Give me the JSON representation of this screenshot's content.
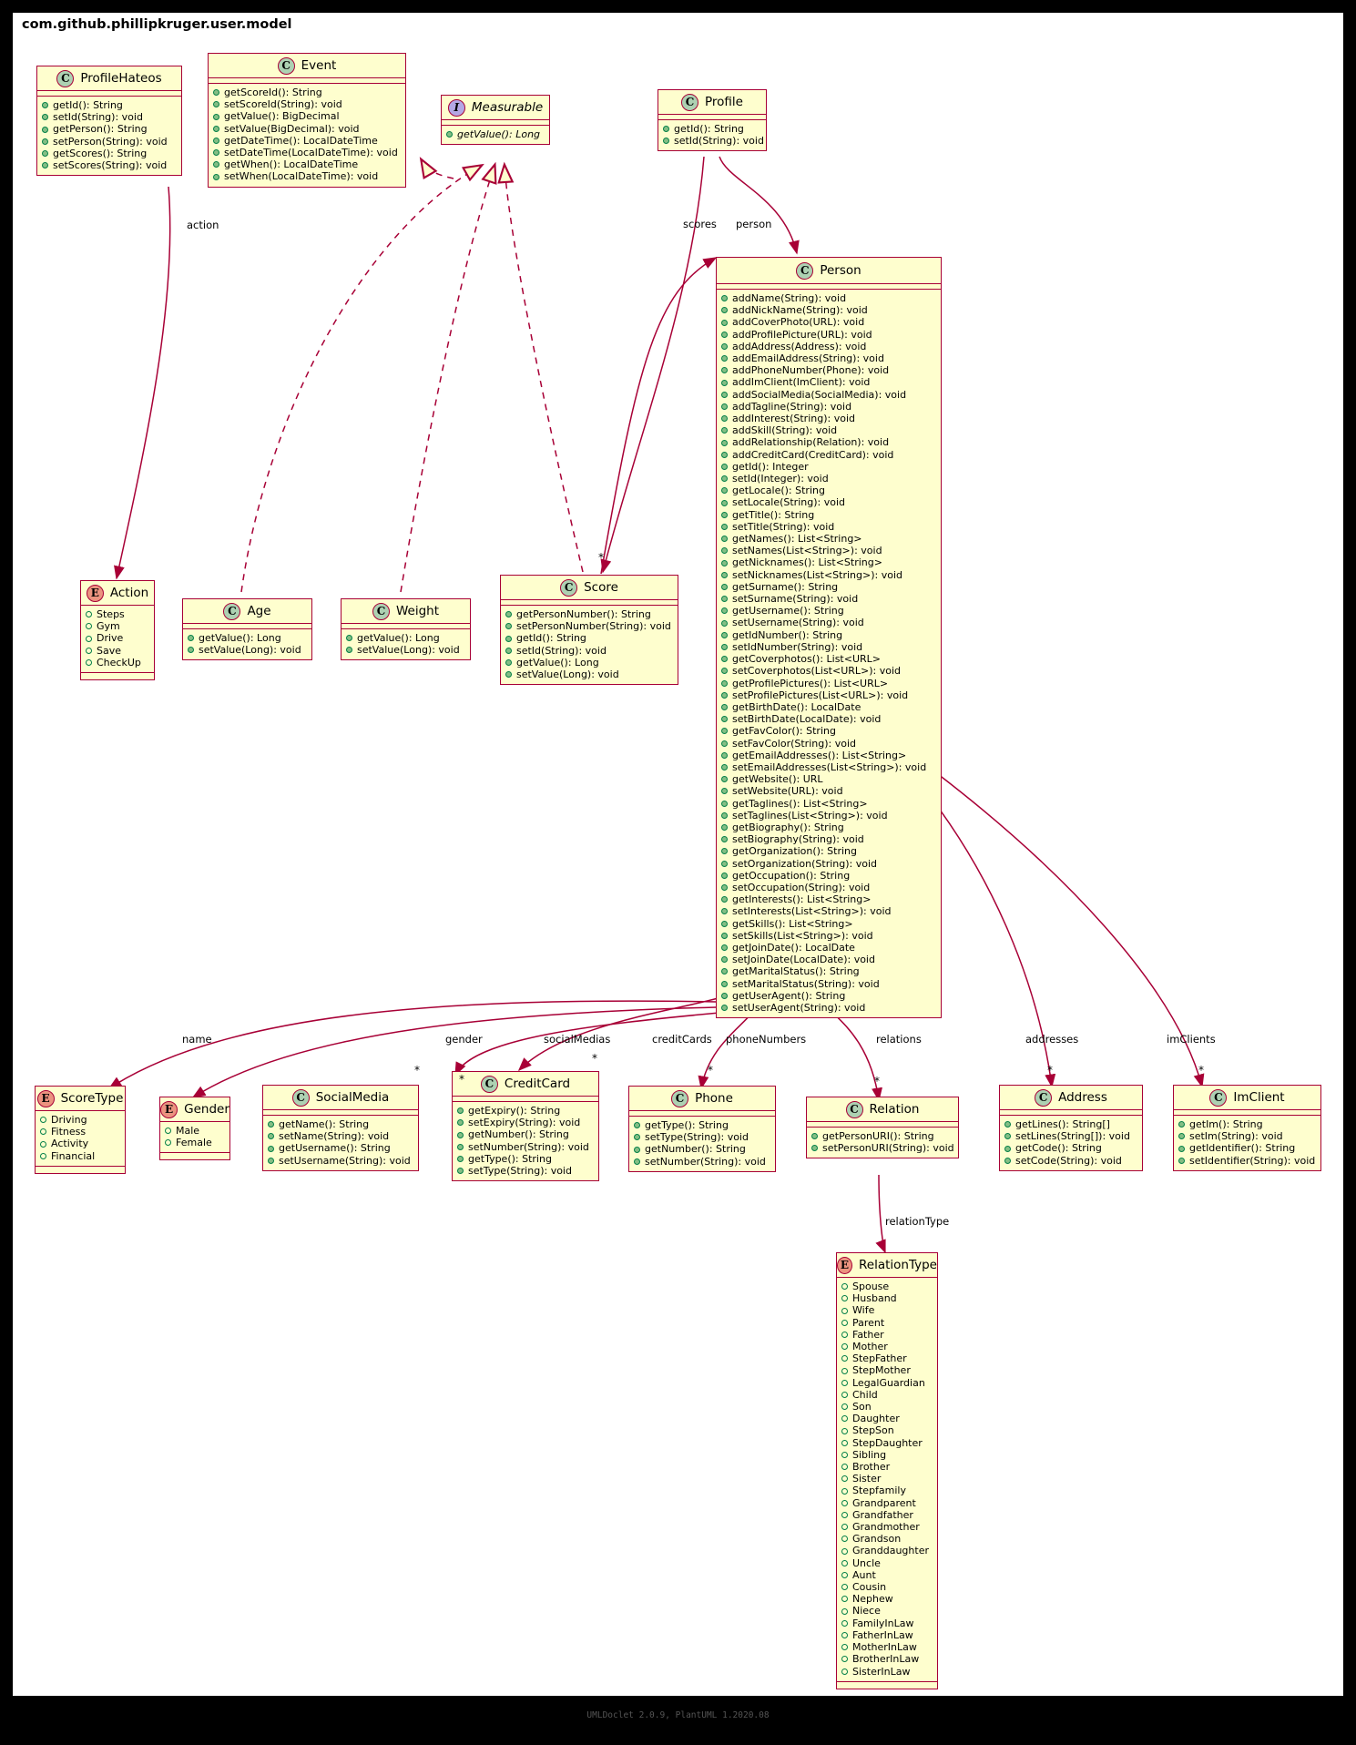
{
  "package": {
    "label": "com.github.phillipkruger.user.model"
  },
  "footer": {
    "text": "UMLDoclet 2.0.9, PlantUML 1.2020.08"
  },
  "colors": {
    "border": "#A80036",
    "fill": "#FEFECE",
    "class_badge": "#ADD1B2",
    "interface_badge": "#B4A7E5",
    "enum_badge": "#EB937F",
    "member_dot": "#038048"
  },
  "nodes": {
    "profilehateos": {
      "stereotype": "C",
      "name": "ProfileHateos",
      "members": [
        "getId(): String",
        "setId(String): void",
        "getPerson(): String",
        "setPerson(String): void",
        "getScores(): String",
        "setScores(String): void"
      ]
    },
    "event": {
      "stereotype": "C",
      "name": "Event",
      "members": [
        "getScoreId(): String",
        "setScoreId(String): void",
        "getValue(): BigDecimal",
        "setValue(BigDecimal): void",
        "getDateTime(): LocalDateTime",
        "setDateTime(LocalDateTime): void",
        "getWhen(): LocalDateTime",
        "setWhen(LocalDateTime): void"
      ]
    },
    "measurable": {
      "stereotype": "I",
      "name": "Measurable",
      "members": [
        "getValue(): Long"
      ]
    },
    "profile": {
      "stereotype": "C",
      "name": "Profile",
      "members": [
        "getId(): String",
        "setId(String): void"
      ]
    },
    "person": {
      "stereotype": "C",
      "name": "Person",
      "members": [
        "addName(String): void",
        "addNickName(String): void",
        "addCoverPhoto(URL): void",
        "addProfilePicture(URL): void",
        "addAddress(Address): void",
        "addEmailAddress(String): void",
        "addPhoneNumber(Phone): void",
        "addImClient(ImClient): void",
        "addSocialMedia(SocialMedia): void",
        "addTagline(String): void",
        "addInterest(String): void",
        "addSkill(String): void",
        "addRelationship(Relation): void",
        "addCreditCard(CreditCard): void",
        "getId(): Integer",
        "setId(Integer): void",
        "getLocale(): String",
        "setLocale(String): void",
        "getTitle(): String",
        "setTitle(String): void",
        "getNames(): List<String>",
        "setNames(List<String>): void",
        "getNicknames(): List<String>",
        "setNicknames(List<String>): void",
        "getSurname(): String",
        "setSurname(String): void",
        "getUsername(): String",
        "setUsername(String): void",
        "getIdNumber(): String",
        "setIdNumber(String): void",
        "getCoverphotos(): List<URL>",
        "setCoverphotos(List<URL>): void",
        "getProfilePictures(): List<URL>",
        "setProfilePictures(List<URL>): void",
        "getBirthDate(): LocalDate",
        "setBirthDate(LocalDate): void",
        "getFavColor(): String",
        "setFavColor(String): void",
        "getEmailAddresses(): List<String>",
        "setEmailAddresses(List<String>): void",
        "getWebsite(): URL",
        "setWebsite(URL): void",
        "getTaglines(): List<String>",
        "setTaglines(List<String>): void",
        "getBiography(): String",
        "setBiography(String): void",
        "getOrganization(): String",
        "setOrganization(String): void",
        "getOccupation(): String",
        "setOccupation(String): void",
        "getInterests(): List<String>",
        "setInterests(List<String>): void",
        "getSkills(): List<String>",
        "setSkills(List<String>): void",
        "getJoinDate(): LocalDate",
        "setJoinDate(LocalDate): void",
        "getMaritalStatus(): String",
        "setMaritalStatus(String): void",
        "getUserAgent(): String",
        "setUserAgent(String): void"
      ]
    },
    "action": {
      "stereotype": "E",
      "name": "Action",
      "members": [
        "Steps",
        "Gym",
        "Drive",
        "Save",
        "CheckUp"
      ]
    },
    "age": {
      "stereotype": "C",
      "name": "Age",
      "members": [
        "getValue(): Long",
        "setValue(Long): void"
      ]
    },
    "weight": {
      "stereotype": "C",
      "name": "Weight",
      "members": [
        "getValue(): Long",
        "setValue(Long): void"
      ]
    },
    "score": {
      "stereotype": "C",
      "name": "Score",
      "members": [
        "getPersonNumber(): String",
        "setPersonNumber(String): void",
        "getId(): String",
        "setId(String): void",
        "getValue(): Long",
        "setValue(Long): void"
      ]
    },
    "scoretype": {
      "stereotype": "E",
      "name": "ScoreType",
      "members": [
        "Driving",
        "Fitness",
        "Activity",
        "Financial"
      ]
    },
    "gender": {
      "stereotype": "E",
      "name": "Gender",
      "members": [
        "Male",
        "Female"
      ]
    },
    "socialmedia": {
      "stereotype": "C",
      "name": "SocialMedia",
      "members": [
        "getName(): String",
        "setName(String): void",
        "getUsername(): String",
        "setUsername(String): void"
      ]
    },
    "creditcard": {
      "stereotype": "C",
      "name": "CreditCard",
      "members": [
        "getExpiry(): String",
        "setExpiry(String): void",
        "getNumber(): String",
        "setNumber(String): void",
        "getType(): String",
        "setType(String): void"
      ]
    },
    "phone": {
      "stereotype": "C",
      "name": "Phone",
      "members": [
        "getType(): String",
        "setType(String): void",
        "getNumber(): String",
        "setNumber(String): void"
      ]
    },
    "relation": {
      "stereotype": "C",
      "name": "Relation",
      "members": [
        "getPersonURI(): String",
        "setPersonURI(String): void"
      ]
    },
    "address": {
      "stereotype": "C",
      "name": "Address",
      "members": [
        "getLines(): String[]",
        "setLines(String[]): void",
        "getCode(): String",
        "setCode(String): void"
      ]
    },
    "imclient": {
      "stereotype": "C",
      "name": "ImClient",
      "members": [
        "getIm(): String",
        "setIm(String): void",
        "getIdentifier(): String",
        "setIdentifier(String): void"
      ]
    },
    "relationtype": {
      "stereotype": "E",
      "name": "RelationType",
      "members": [
        "Spouse",
        "Husband",
        "Wife",
        "Parent",
        "Father",
        "Mother",
        "StepFather",
        "StepMother",
        "LegalGuardian",
        "Child",
        "Son",
        "Daughter",
        "StepSon",
        "StepDaughter",
        "Sibling",
        "Brother",
        "Sister",
        "Stepfamily",
        "Grandparent",
        "Grandfather",
        "Grandmother",
        "Grandson",
        "Granddaughter",
        "Uncle",
        "Aunt",
        "Cousin",
        "Nephew",
        "Niece",
        "FamilyInLaw",
        "FatherInLaw",
        "MotherInLaw",
        "BrotherInLaw",
        "SisterInLaw"
      ]
    }
  },
  "edge_labels": {
    "action": "action",
    "scores": "scores",
    "person": "person",
    "name": "name",
    "gender": "gender",
    "socialMedias": "socialMedias",
    "creditCards": "creditCards",
    "phoneNumbers": "phoneNumbers",
    "relations": "relations",
    "addresses": "addresses",
    "imClients": "imClients",
    "relationType": "relationType"
  },
  "multiplicities": {
    "many": "*"
  }
}
